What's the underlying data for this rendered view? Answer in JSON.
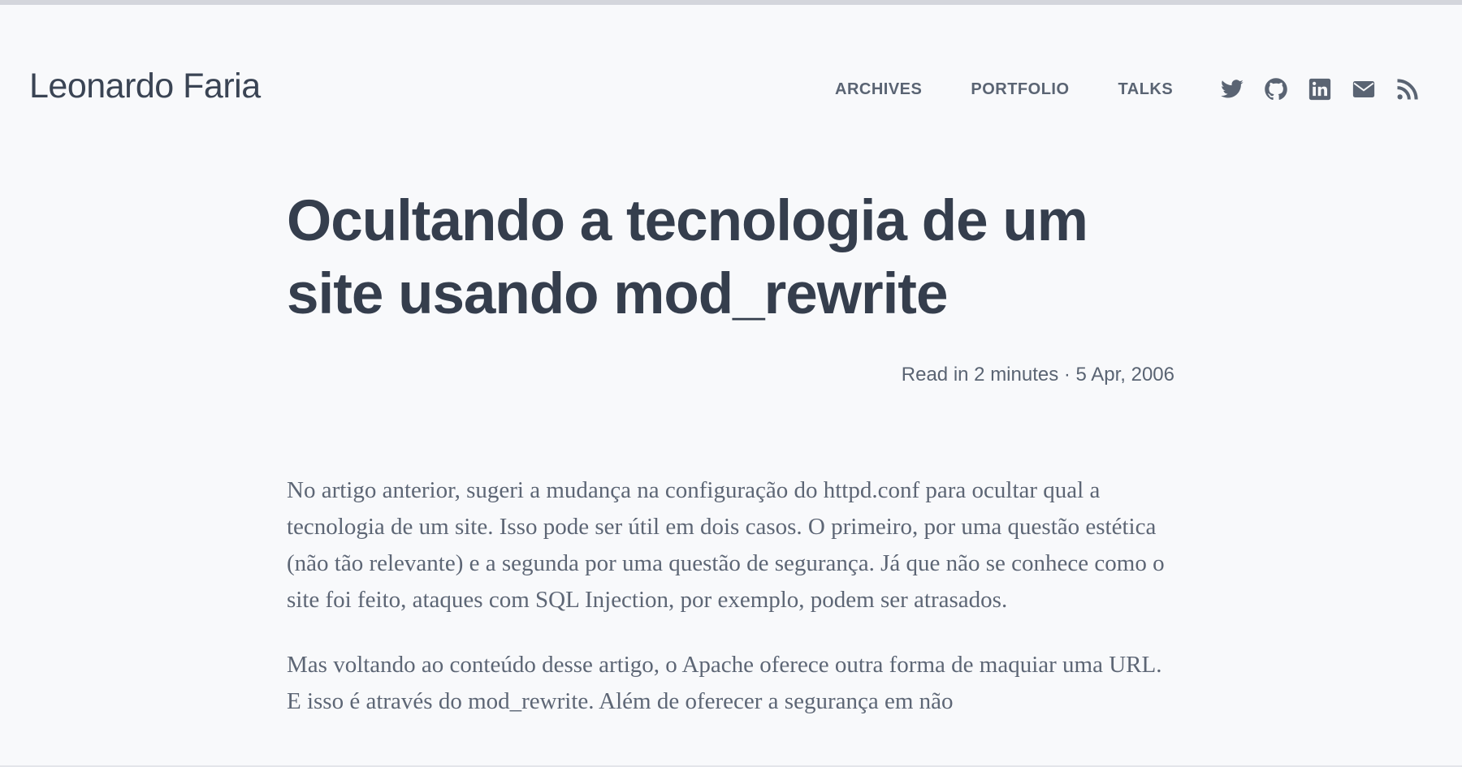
{
  "header": {
    "site_title": "Leonardo Faria",
    "nav": [
      {
        "label": "ARCHIVES"
      },
      {
        "label": "PORTFOLIO"
      },
      {
        "label": "TALKS"
      }
    ],
    "social_icons": [
      "twitter-icon",
      "github-icon",
      "linkedin-icon",
      "email-icon",
      "rss-icon"
    ]
  },
  "post": {
    "title": "Ocultando a tecnologia de um site usando mod_rewrite",
    "meta": "Read in 2 minutes · 5 Apr, 2006",
    "paragraphs": [
      "No artigo anterior, sugeri a mudança na configuração do httpd.conf para ocultar qual a tecnologia de um site. Isso pode ser útil em dois casos. O primeiro, por uma questão estética (não tão relevante) e a segunda por uma questão de segurança. Já que não se conhece como o site foi feito, ataques com SQL Injection, por exemplo, podem ser atrasados.",
      "Mas voltando ao conteúdo desse artigo, o Apache oferece outra forma de maquiar uma URL. E isso é através do mod_rewrite. Além de oferecer a segurança em não"
    ]
  },
  "colors": {
    "background": "#f8f9fb",
    "title": "#353e4d",
    "nav": "#5a6473",
    "body_text": "#5d6675"
  }
}
